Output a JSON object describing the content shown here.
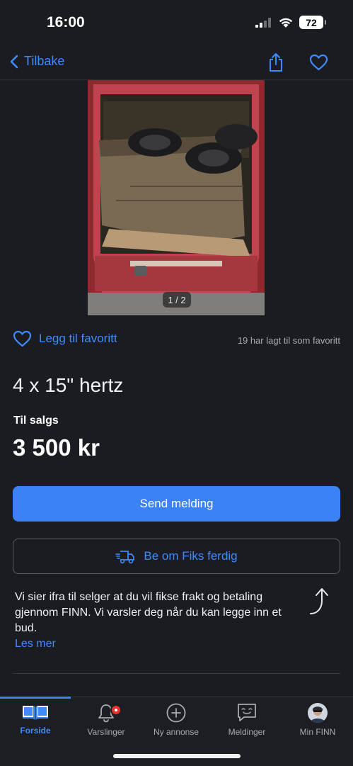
{
  "status_bar": {
    "time": "16:00",
    "battery": "72"
  },
  "nav": {
    "back_label": "Tilbake"
  },
  "listing": {
    "image_counter": "1 / 2",
    "favorite_label": "Legg til favoritt",
    "favorite_count_text": "19 har lagt til som favoritt",
    "title": "4 x 15\" hertz",
    "sale_type": "Til salgs",
    "price": "3 500 kr"
  },
  "actions": {
    "send_message": "Send melding",
    "fiks_ferdig": "Be om Fiks ferdig"
  },
  "info": {
    "text": "Vi sier ifra til selger at du vil fikse frakt og betaling gjennom FINN. Vi varsler deg når du kan legge inn et bud.",
    "link": "Les mer"
  },
  "tabbar": {
    "tabs": [
      {
        "label": "Forside",
        "icon": "book-icon",
        "active": true
      },
      {
        "label": "Varslinger",
        "icon": "bell-icon",
        "active": false
      },
      {
        "label": "Ny annonse",
        "icon": "plus-circle-icon",
        "active": false
      },
      {
        "label": "Meldinger",
        "icon": "chat-icon",
        "active": false
      },
      {
        "label": "Min FINN",
        "icon": "avatar",
        "active": false
      }
    ]
  },
  "colors": {
    "accent": "#3a82f6",
    "background": "#1b1c22",
    "badge": "#e8322d"
  }
}
